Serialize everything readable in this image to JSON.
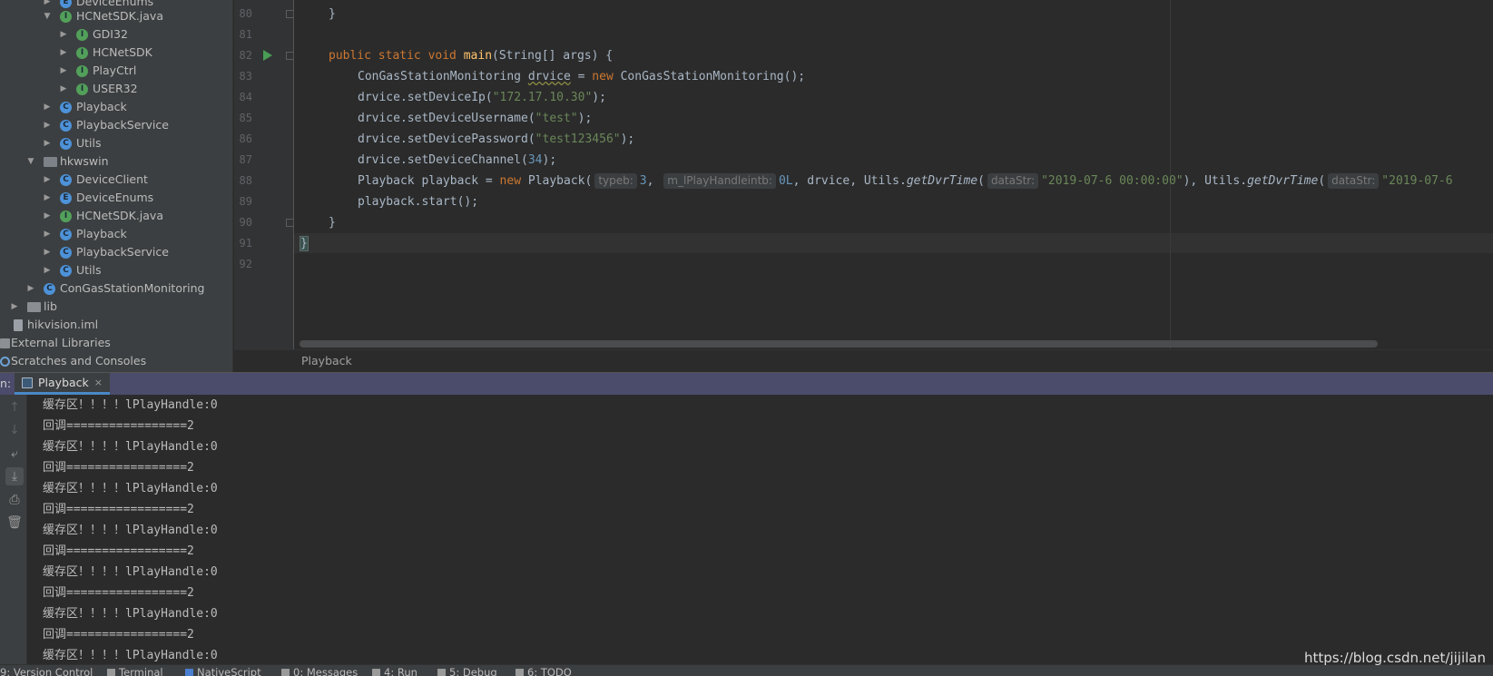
{
  "project_tree": {
    "items": [
      {
        "label": "DeviceEnums",
        "icon": "enum-icon"
      },
      {
        "label": "HCNetSDK.java",
        "icon": "interface-icon"
      },
      {
        "label": "GDI32",
        "icon": "interface-icon"
      },
      {
        "label": "HCNetSDK",
        "icon": "interface-icon"
      },
      {
        "label": "PlayCtrl",
        "icon": "interface-icon"
      },
      {
        "label": "USER32",
        "icon": "interface-icon"
      },
      {
        "label": "Playback",
        "icon": "class-icon"
      },
      {
        "label": "PlaybackService",
        "icon": "class-icon"
      },
      {
        "label": "Utils",
        "icon": "class-icon"
      },
      {
        "label": "hkwswin",
        "icon": "folder-icon"
      },
      {
        "label": "DeviceClient",
        "icon": "class-icon"
      },
      {
        "label": "DeviceEnums",
        "icon": "enum-icon"
      },
      {
        "label": "HCNetSDK.java",
        "icon": "interface-icon"
      },
      {
        "label": "Playback",
        "icon": "class-icon"
      },
      {
        "label": "PlaybackService",
        "icon": "class-icon"
      },
      {
        "label": "Utils",
        "icon": "class-icon"
      },
      {
        "label": "ConGasStationMonitoring",
        "icon": "class-icon"
      },
      {
        "label": "lib",
        "icon": "folder-icon"
      },
      {
        "label": "hikvision.iml",
        "icon": "file-icon"
      },
      {
        "label": "External Libraries",
        "icon": "library-icon"
      },
      {
        "label": "Scratches and Consoles",
        "icon": "scratch-icon"
      }
    ]
  },
  "editor": {
    "line_numbers": [
      "80",
      "81",
      "82",
      "83",
      "84",
      "85",
      "86",
      "87",
      "88",
      "89",
      "90",
      "91",
      "92"
    ],
    "code": {
      "l80": "}",
      "l82_kw": "public static void",
      "l82_fn": "main",
      "l82_rest": "(String[] args) {",
      "l83_a": "ConGasStationMonitoring ",
      "l83_var": "drvice",
      "l83_b": " = ",
      "l83_new": "new",
      "l83_c": " ConGasStationMonitoring();",
      "l84_a": "drvice.setDeviceIp(",
      "l84_str": "\"172.17.10.30\"",
      "l84_b": ");",
      "l85_a": "drvice.setDeviceUsername(",
      "l85_str": "\"test\"",
      "l85_b": ");",
      "l86_a": "drvice.setDevicePassword(",
      "l86_str": "\"test123456\"",
      "l86_b": ");",
      "l87_a": "drvice.setDeviceChannel(",
      "l87_num": "34",
      "l87_b": ");",
      "l88_a": "Playback playback = ",
      "l88_new": "new",
      "l88_b": " Playback(",
      "l88_hint1": "typeb:",
      "l88_num1": "3",
      "l88_c": ", ",
      "l88_hint2": "m_lPlayHandleintb:",
      "l88_num2": "0L",
      "l88_d": ", drvice, Utils.",
      "l88_fn1": "getDvrTime",
      "l88_e": "(",
      "l88_hint3": "dataStr:",
      "l88_str1": "\"2019-07-6 00:00:00\"",
      "l88_f": "), Utils.",
      "l88_fn2": "getDvrTime",
      "l88_g": "(",
      "l88_hint4": "dataStr:",
      "l88_str2": "\"2019-07-6",
      "l89": "playback.start();",
      "l90": "}",
      "l91": "}"
    }
  },
  "breadcrumbs": {
    "item": "Playback"
  },
  "run_window": {
    "prefix": "n:",
    "tab_label": "Playback",
    "tab_close": "×",
    "toolbar": [
      "up-arrow-icon",
      "down-arrow-icon",
      "soft-wrap-icon",
      "scroll-to-end-icon",
      "print-icon",
      "trash-icon"
    ],
    "console_lines": [
      "缓存区！！！！lPlayHandle:0",
      "回调=================2",
      "缓存区！！！！lPlayHandle:0",
      "回调=================2",
      "缓存区！！！！lPlayHandle:0",
      "回调=================2",
      "缓存区！！！！lPlayHandle:0",
      "回调=================2",
      "缓存区！！！！lPlayHandle:0",
      "回调=================2",
      "缓存区！！！！lPlayHandle:0",
      "回调=================2",
      "缓存区！！！！lPlayHandle:0"
    ]
  },
  "bottom_bar": {
    "items": [
      "9: Version Control",
      "Terminal",
      "NativeScript",
      "0: Messages",
      "4: Run",
      "5: Debug",
      "6: TODO"
    ]
  },
  "watermark": "https://blog.csdn.net/jijilan"
}
